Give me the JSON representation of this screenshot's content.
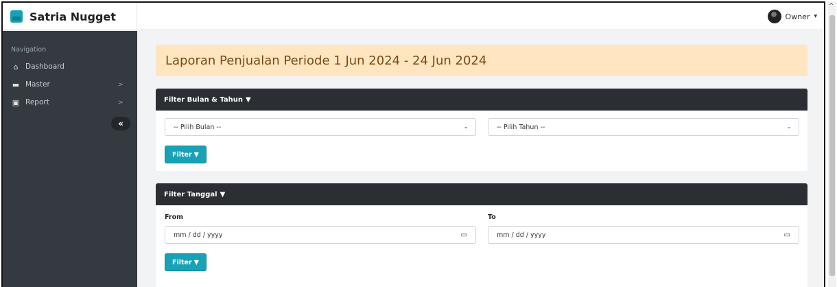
{
  "brand": {
    "name": "Satria Nugget",
    "logo_icon": "chart-area-icon",
    "color": "#17a2b8"
  },
  "user": {
    "name": "Owner",
    "caret": "▾"
  },
  "sidebar": {
    "heading": "Navigation",
    "items": [
      {
        "label": "Dashboard",
        "icon": "home-icon",
        "glyph": "⌂",
        "has_submenu": false
      },
      {
        "label": "Master",
        "icon": "folder-icon",
        "glyph": "▬",
        "chevron": ">",
        "has_submenu": true
      },
      {
        "label": "Report",
        "icon": "file-excel-icon",
        "glyph": "▣",
        "chevron": ">",
        "has_submenu": true
      }
    ],
    "collapse_glyph": "«"
  },
  "page": {
    "title": "Laporan Penjualan Periode 1 Jun 2024 - 24 Jun 2024"
  },
  "filter_month_year": {
    "header": "Filter Bulan & Tahun",
    "month_select": {
      "value": "-- Pilih Bulan --"
    },
    "year_select": {
      "value": "-- Pilih Tahun --"
    },
    "button_label": "Filter"
  },
  "filter_date": {
    "header": "Filter Tanggal",
    "from_label": "From",
    "to_label": "To",
    "from_placeholder": "mm / dd / yyyy",
    "to_placeholder": "mm / dd / yyyy",
    "button_label": "Filter"
  },
  "icons": {
    "filter": "▼",
    "select_arrow": "⌄",
    "calendar": "▭",
    "scroll_up": "^"
  },
  "colors": {
    "sidebar": "#343a40",
    "card_header": "#2b2f33",
    "accent": "#17a2b8",
    "title_bg": "#ffe5c0"
  }
}
